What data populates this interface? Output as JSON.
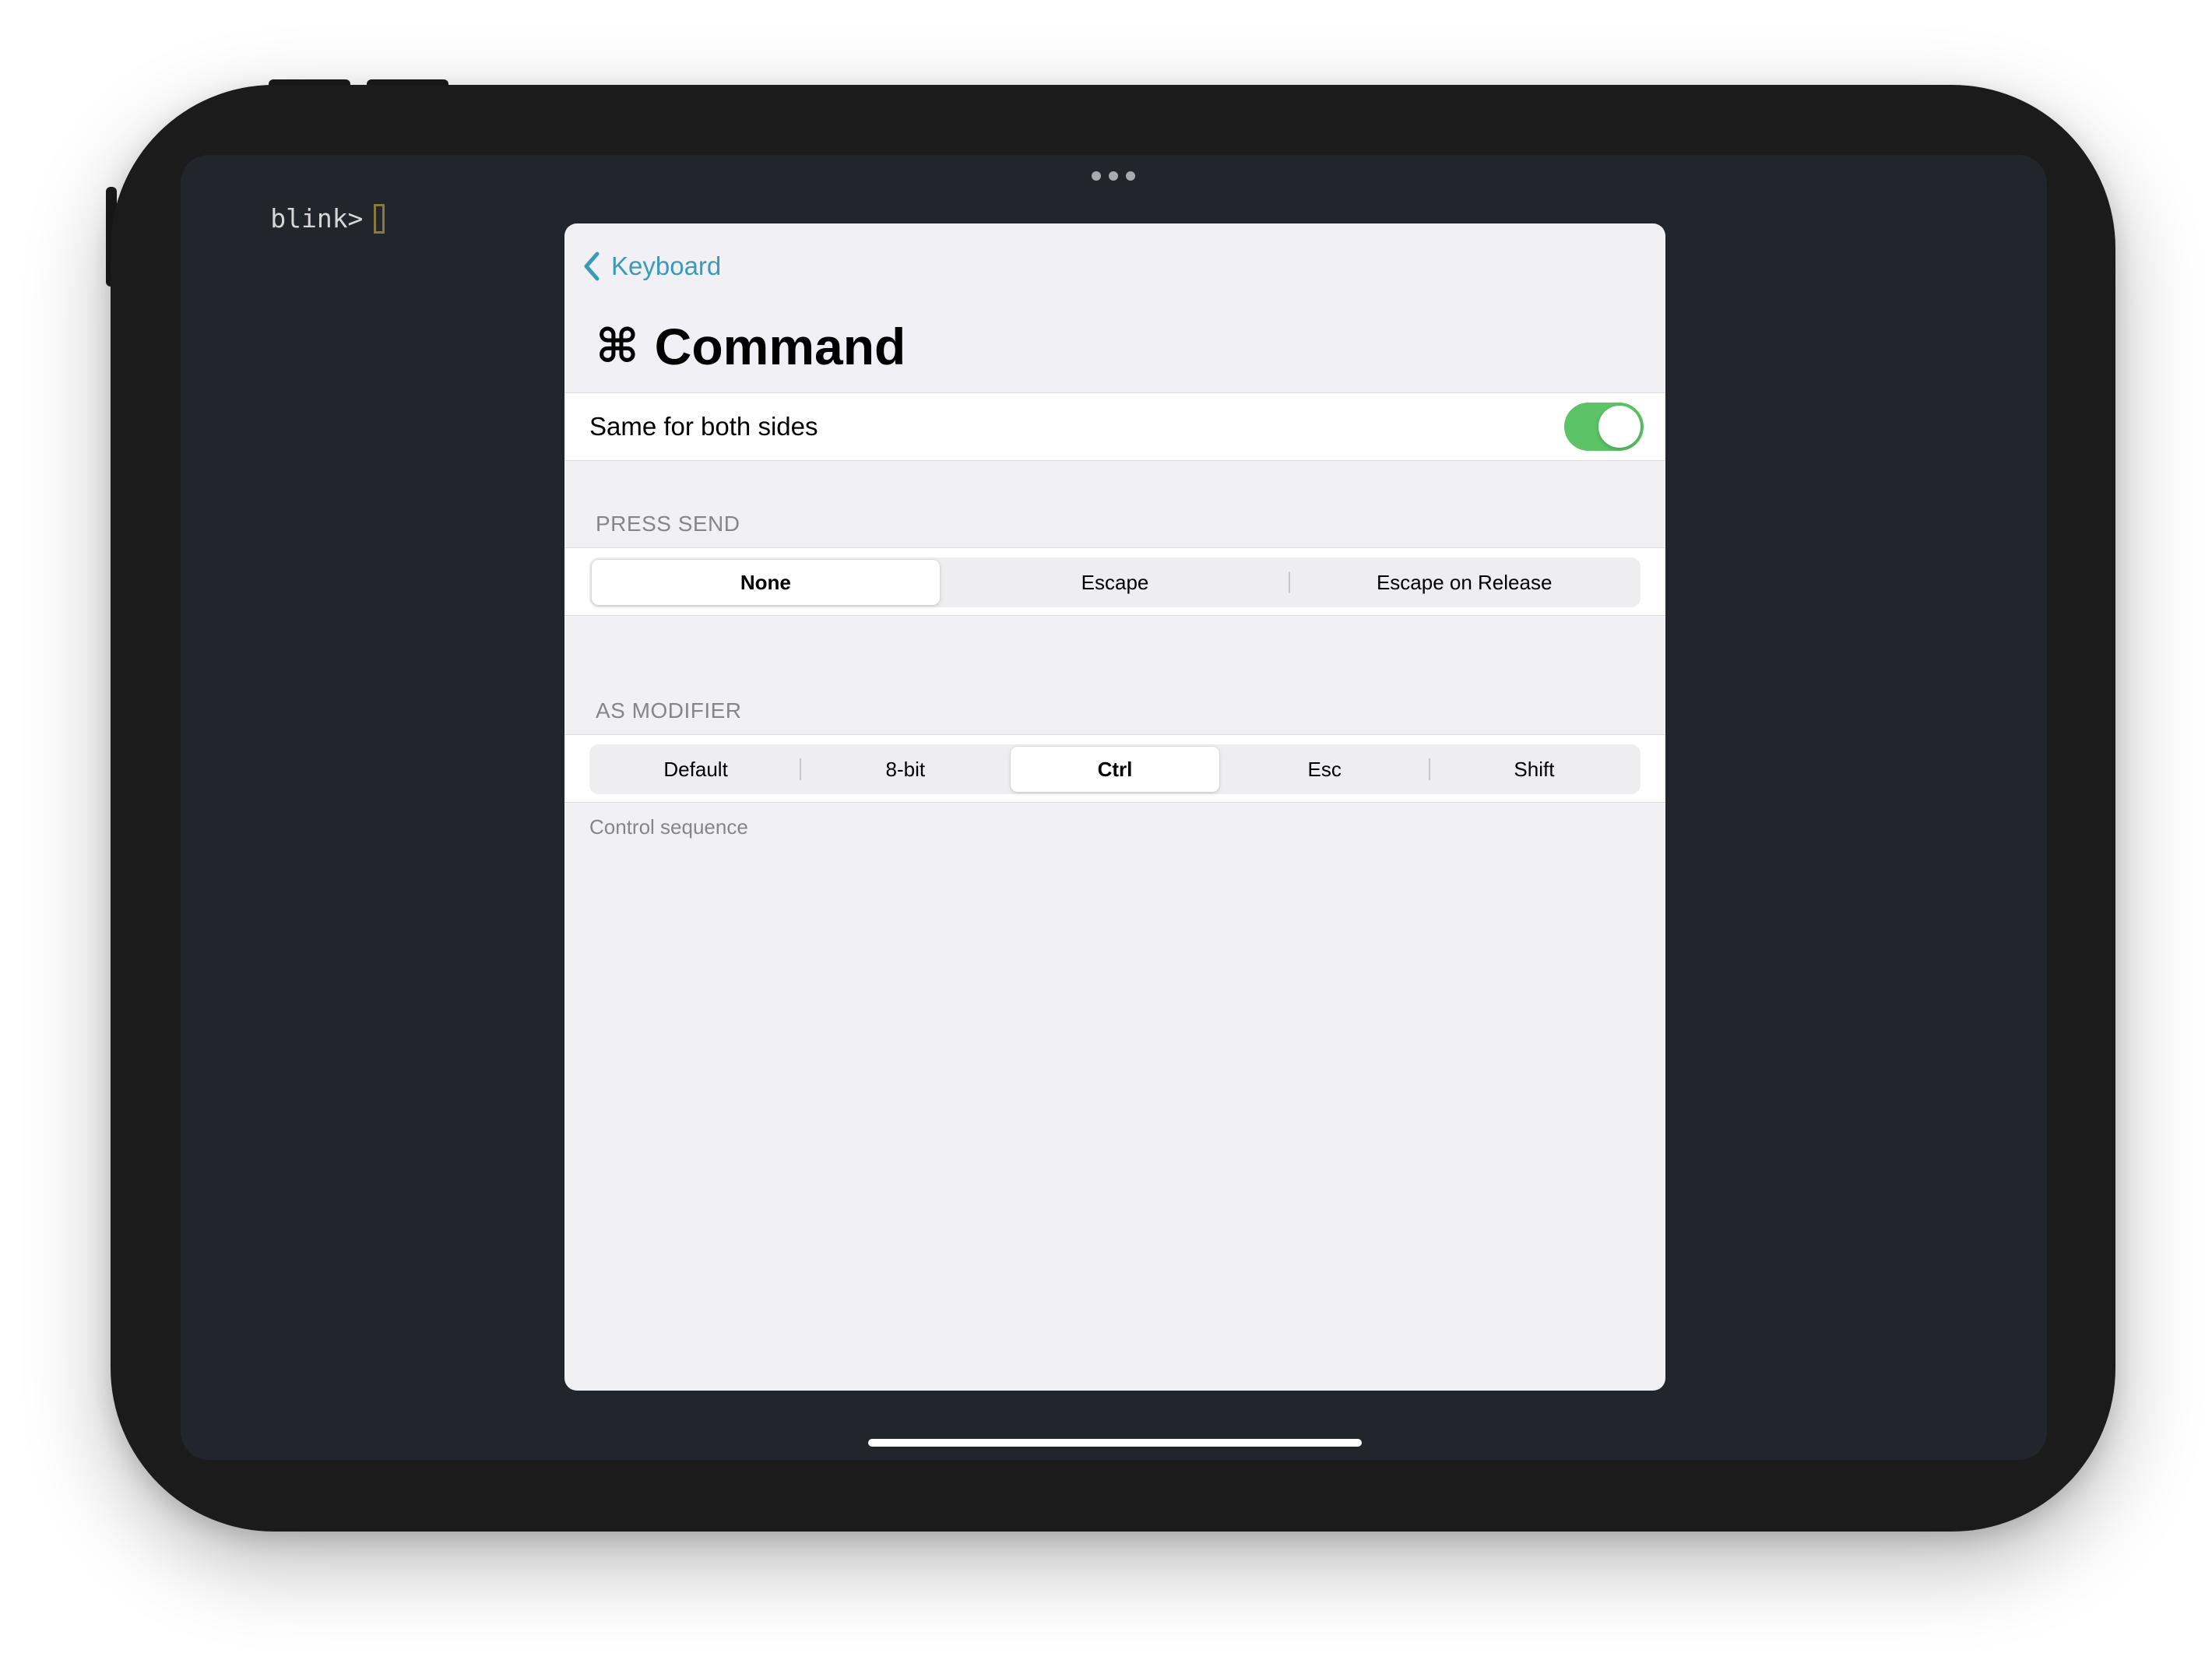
{
  "terminal": {
    "prompt": "blink>"
  },
  "sheet": {
    "back_label": "Keyboard",
    "title_glyph": "⌘",
    "title": "Command",
    "same_for_both_sides": {
      "label": "Same for both sides",
      "enabled": true,
      "on_color": "#5cc466"
    },
    "press_send": {
      "header": "PRESS SEND",
      "options": [
        "None",
        "Escape",
        "Escape on Release"
      ],
      "selected": "None"
    },
    "as_modifier": {
      "header": "AS MODIFIER",
      "options": [
        "Default",
        "8-bit",
        "Ctrl",
        "Esc",
        "Shift"
      ],
      "selected": "Ctrl",
      "footer": "Control sequence"
    }
  },
  "colors": {
    "accent": "#3b9ab8",
    "terminal_bg": "#22252c",
    "sheet_bg": "#f1f0f5"
  }
}
